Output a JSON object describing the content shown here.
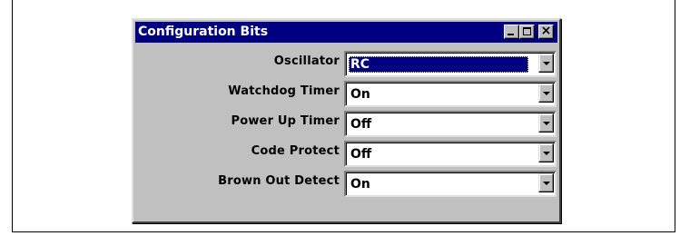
{
  "window": {
    "title": "Configuration Bits",
    "controls": {
      "minimize": "minimize-icon",
      "maximize": "maximize-icon",
      "close": "close-icon",
      "close_glyph": "×"
    }
  },
  "settings": [
    {
      "label": "Oscillator",
      "value": "RC",
      "selected": true
    },
    {
      "label": "Watchdog Timer",
      "value": "On",
      "selected": false
    },
    {
      "label": "Power Up Timer",
      "value": "Off",
      "selected": false
    },
    {
      "label": "Code Protect",
      "value": "Off",
      "selected": false
    },
    {
      "label": "Brown Out Detect",
      "value": "On",
      "selected": false
    }
  ],
  "colors": {
    "titlebar": "#000080",
    "face": "#c0c0c0",
    "selection": "#000080"
  }
}
